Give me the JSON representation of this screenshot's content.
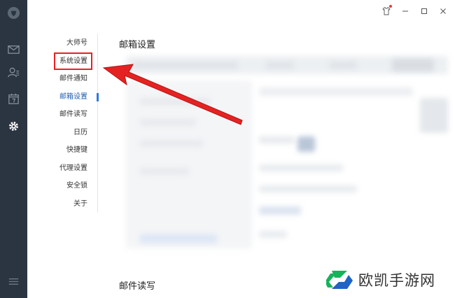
{
  "menu": {
    "items": [
      {
        "label": "大师号"
      },
      {
        "label": "系统设置"
      },
      {
        "label": "邮件通知"
      },
      {
        "label": "邮箱设置"
      },
      {
        "label": "邮件读写"
      },
      {
        "label": "日历"
      },
      {
        "label": "快捷键"
      },
      {
        "label": "代理设置"
      },
      {
        "label": "安全锁"
      },
      {
        "label": "关于"
      }
    ],
    "active_index": 3
  },
  "content": {
    "page_title": "邮箱设置",
    "next_section_title": "邮件读写"
  },
  "watermark": {
    "text": "欧凯手游网"
  },
  "colors": {
    "rail": "#2b3542",
    "accent": "#2e7ae0",
    "highlight": "#e52222",
    "arrow": "#e52222",
    "watermark_green": "#16b35b",
    "watermark_blue": "#1f63c6"
  }
}
